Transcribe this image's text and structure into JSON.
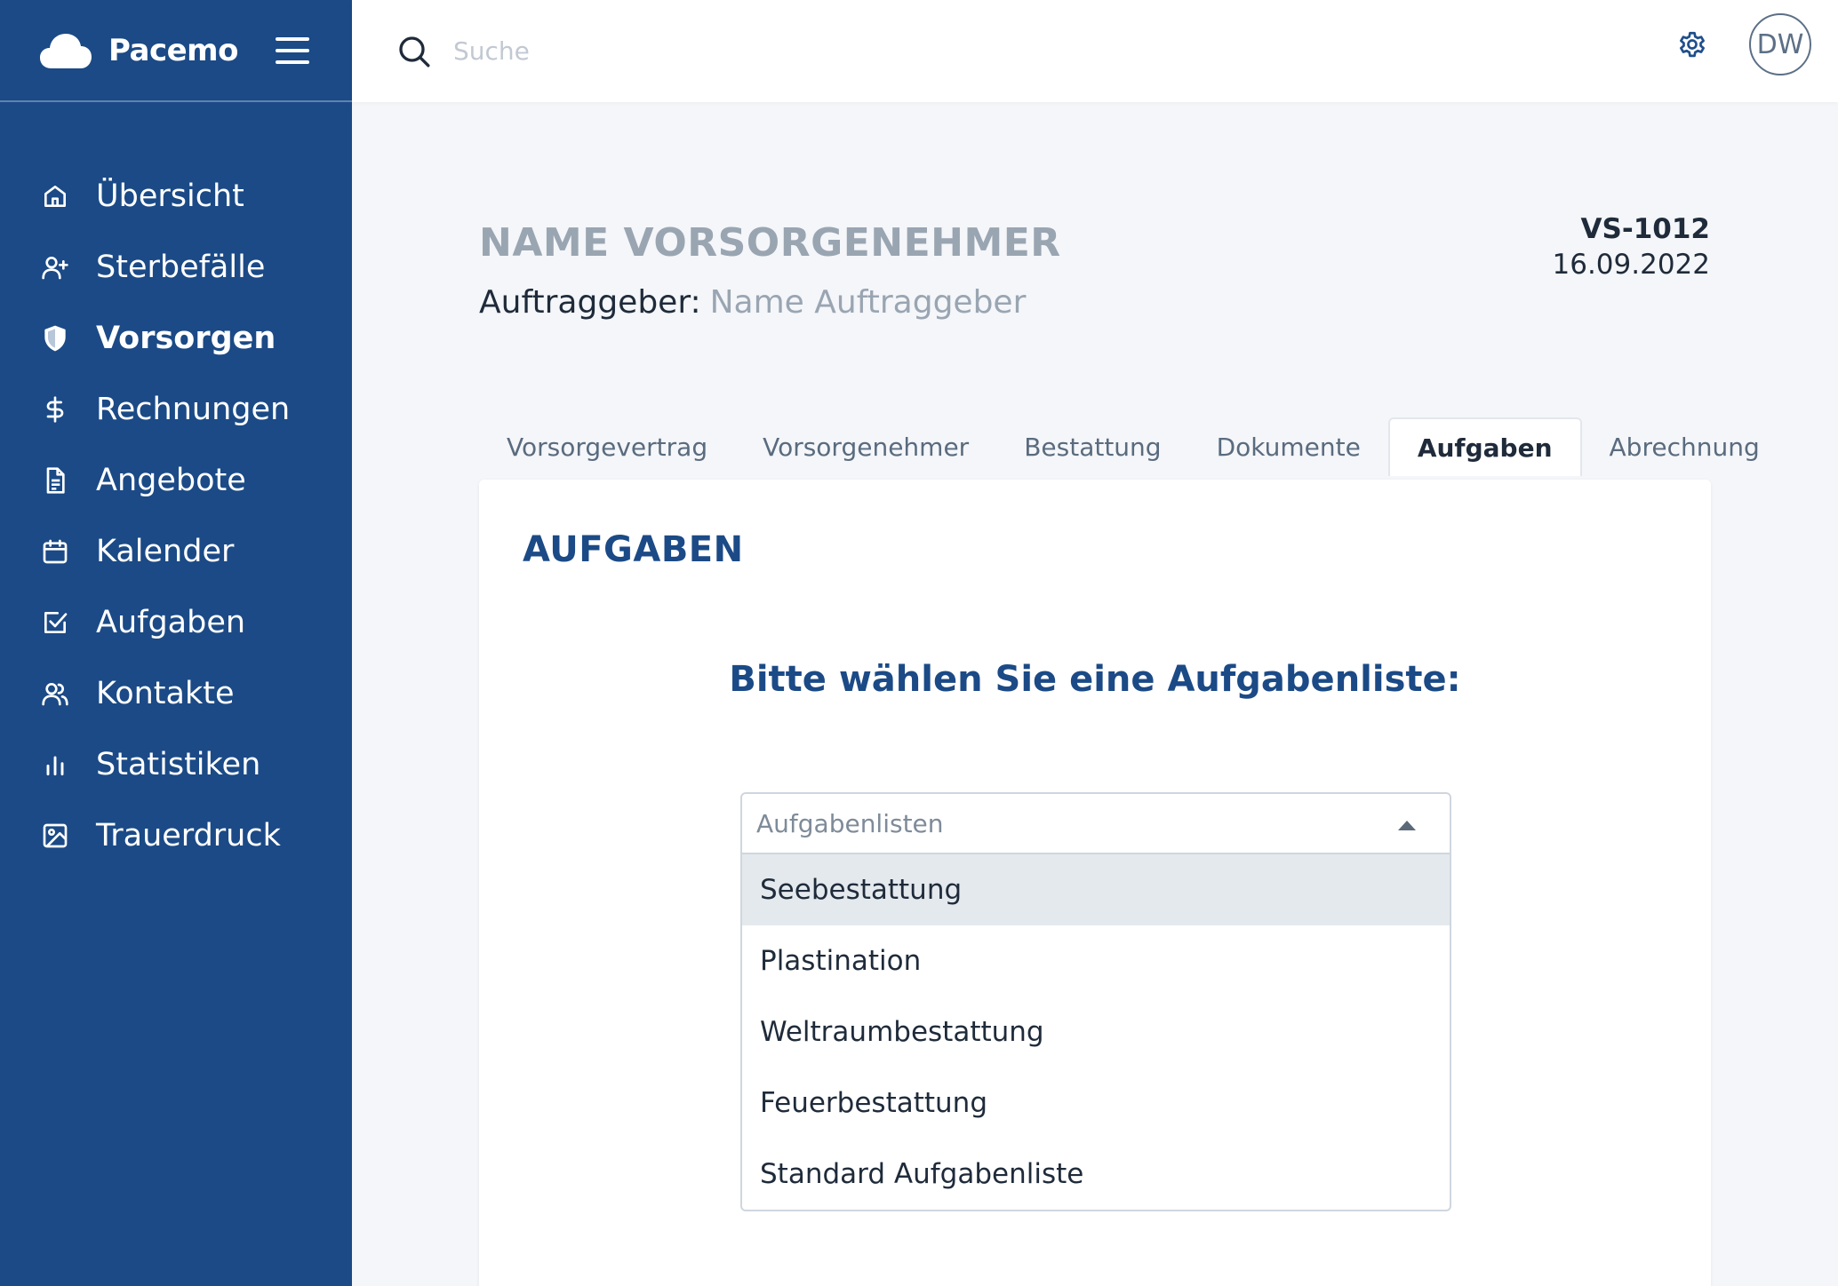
{
  "brand": {
    "name": "Pacemo"
  },
  "sidebar": {
    "items": [
      {
        "label": "Übersicht",
        "icon": "home-icon",
        "active": false
      },
      {
        "label": "Sterbefälle",
        "icon": "user-plus-icon",
        "active": false
      },
      {
        "label": "Vorsorgen",
        "icon": "shield-icon",
        "active": true
      },
      {
        "label": "Rechnungen",
        "icon": "dollar-icon",
        "active": false
      },
      {
        "label": "Angebote",
        "icon": "document-icon",
        "active": false
      },
      {
        "label": "Kalender",
        "icon": "calendar-icon",
        "active": false
      },
      {
        "label": "Aufgaben",
        "icon": "checkbox-icon",
        "active": false
      },
      {
        "label": "Kontakte",
        "icon": "users-icon",
        "active": false
      },
      {
        "label": "Statistiken",
        "icon": "bar-chart-icon",
        "active": false
      },
      {
        "label": "Trauerdruck",
        "icon": "image-icon",
        "active": false
      }
    ]
  },
  "topbar": {
    "search_placeholder": "Suche",
    "search_value": "",
    "avatar_initials": "DW"
  },
  "header": {
    "title": "NAME VORSORGENEHMER",
    "client_label": "Auftraggeber:",
    "client_value": "Name Auftraggeber",
    "ref_id": "VS-1012",
    "ref_date": "16.09.2022"
  },
  "tabs": [
    {
      "label": "Vorsorgevertrag",
      "active": false
    },
    {
      "label": "Vorsorgenehmer",
      "active": false
    },
    {
      "label": "Bestattung",
      "active": false
    },
    {
      "label": "Dokumente",
      "active": false
    },
    {
      "label": "Aufgaben",
      "active": true
    },
    {
      "label": "Abrechnung",
      "active": false
    }
  ],
  "card": {
    "title": "AUFGABEN",
    "prompt": "Bitte wählen Sie eine Aufgabenliste:",
    "select_placeholder": "Aufgabenlisten",
    "options": [
      "Seebestattung",
      "Plastination",
      "Weltraumbestattung",
      "Feuerbestattung",
      "Standard Aufgabenliste"
    ],
    "highlighted_option": 0
  },
  "colors": {
    "sidebar_bg": "#1b4a86",
    "accent": "#1b4a86",
    "muted_text": "#9aa5b2",
    "page_bg": "#f4f6f9"
  }
}
